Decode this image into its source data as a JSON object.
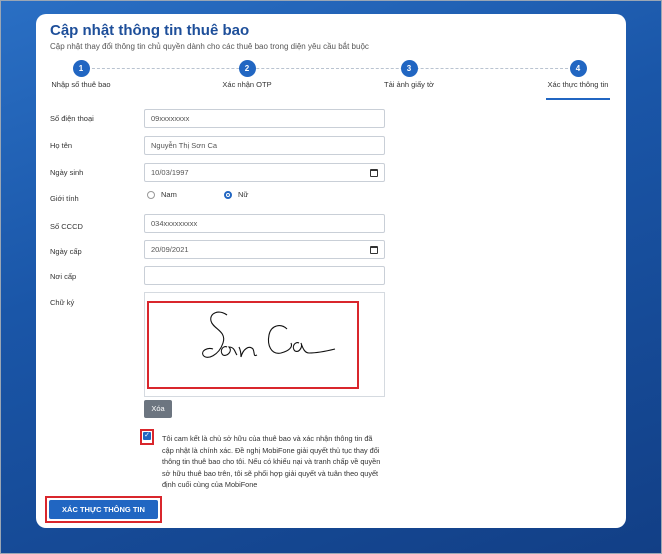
{
  "header": {
    "title": "Cập nhật thông tin thuê bao",
    "subtitle": "Cập nhật thay đổi thông tin chủ quyền dành cho các thuê bao trong diện yêu cầu bắt buộc"
  },
  "steps": [
    {
      "number": "1",
      "label": "Nhập số thuê bao"
    },
    {
      "number": "2",
      "label": "Xác nhận OTP"
    },
    {
      "number": "3",
      "label": "Tải ảnh giấy tờ"
    },
    {
      "number": "4",
      "label": "Xác thực thông tin"
    }
  ],
  "form": {
    "phone": {
      "label": "Số điện thoại",
      "value": "09xxxxxxxx"
    },
    "name": {
      "label": "Họ tên",
      "value": "Nguyễn Thị Sơn Ca"
    },
    "dob": {
      "label": "Ngày sinh",
      "value": "10/03/1997"
    },
    "gender": {
      "label": "Giới tính",
      "options": [
        "Nam",
        "Nữ"
      ],
      "selected": "Nữ"
    },
    "cccd": {
      "label": "Số CCCD",
      "value": "034xxxxxxxxx"
    },
    "issue_date": {
      "label": "Ngày cấp",
      "value": "20/09/2021"
    },
    "issue_place": {
      "label": "Nơi cấp",
      "value": ""
    },
    "signature": {
      "label": "Chữ ký",
      "text": "Sơn Ca"
    }
  },
  "delete_button": "Xóa",
  "commitment": {
    "checked": true,
    "text": "Tôi cam kết là chủ sở hữu của thuê bao và xác nhận thông tin đã cập nhật là chính xác. Đề nghị MobiFone giải quyết thủ tục thay đổi thông tin thuê bao cho tôi. Nếu có khiếu nại và tranh chấp về quyền sở hữu thuê bao trên, tôi sẽ phối hợp giải quyết và tuân theo quyết định cuối cùng của MobiFone"
  },
  "submit_button": "XÁC THỰC THÔNG TIN",
  "colors": {
    "accent": "#2166c2",
    "highlight": "#d9262c",
    "background": "#1a56a8"
  }
}
